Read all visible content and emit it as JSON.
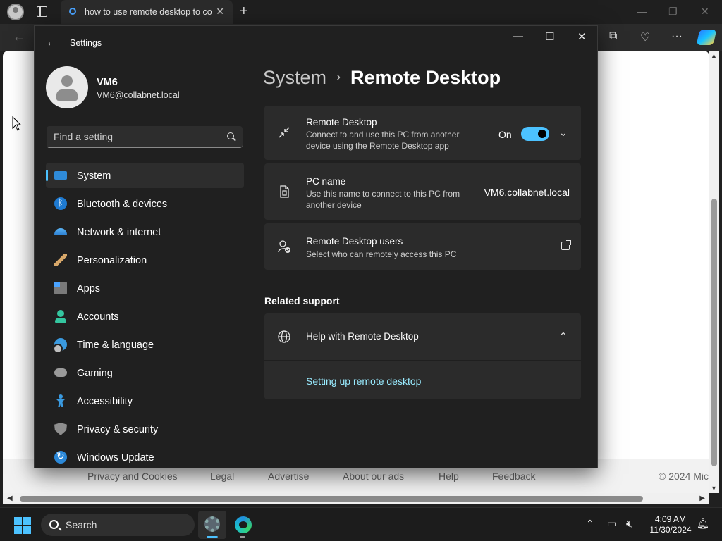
{
  "browser": {
    "tab_title": "how to use remote desktop to co",
    "footer_links": [
      "Privacy and Cookies",
      "Legal",
      "Advertise",
      "About our ads",
      "Help",
      "Feedback"
    ],
    "footer_copyright": "© 2024 Mic"
  },
  "settings": {
    "window_title": "Settings",
    "user": {
      "name": "VM6",
      "email": "VM6@collabnet.local"
    },
    "search_placeholder": "Find a setting",
    "nav": [
      {
        "label": "System",
        "icon": "monitor-icon",
        "active": true
      },
      {
        "label": "Bluetooth & devices",
        "icon": "bluetooth-icon"
      },
      {
        "label": "Network & internet",
        "icon": "wifi-icon"
      },
      {
        "label": "Personalization",
        "icon": "brush-icon"
      },
      {
        "label": "Apps",
        "icon": "apps-icon"
      },
      {
        "label": "Accounts",
        "icon": "person-icon"
      },
      {
        "label": "Time & language",
        "icon": "globe-clock-icon"
      },
      {
        "label": "Gaming",
        "icon": "gamepad-icon"
      },
      {
        "label": "Accessibility",
        "icon": "accessibility-icon"
      },
      {
        "label": "Privacy & security",
        "icon": "shield-icon"
      },
      {
        "label": "Windows Update",
        "icon": "update-icon"
      }
    ],
    "breadcrumb": {
      "parent": "System",
      "separator": "›",
      "current": "Remote Desktop"
    },
    "remote_desktop": {
      "title": "Remote Desktop",
      "description_line1": "Connect to and use this PC from another",
      "description_line2": "device using the Remote Desktop app",
      "toggle_label": "On",
      "toggle_on": true
    },
    "pc_name": {
      "title": "PC name",
      "description_line1": "Use this name to connect to this PC from",
      "description_line2": "another device",
      "value": "VM6.collabnet.local"
    },
    "rd_users": {
      "title": "Remote Desktop users",
      "description": "Select who can remotely access this PC"
    },
    "related_support": {
      "heading": "Related support",
      "help_title": "Help with Remote Desktop",
      "link": "Setting up remote desktop"
    }
  },
  "taskbar": {
    "search_label": "Search",
    "time": "4:09 AM",
    "date": "11/30/2024"
  },
  "colors": {
    "accent": "#4cc2ff",
    "window_bg": "#202020",
    "card_bg": "#2b2b2b",
    "link": "#99ebff"
  }
}
